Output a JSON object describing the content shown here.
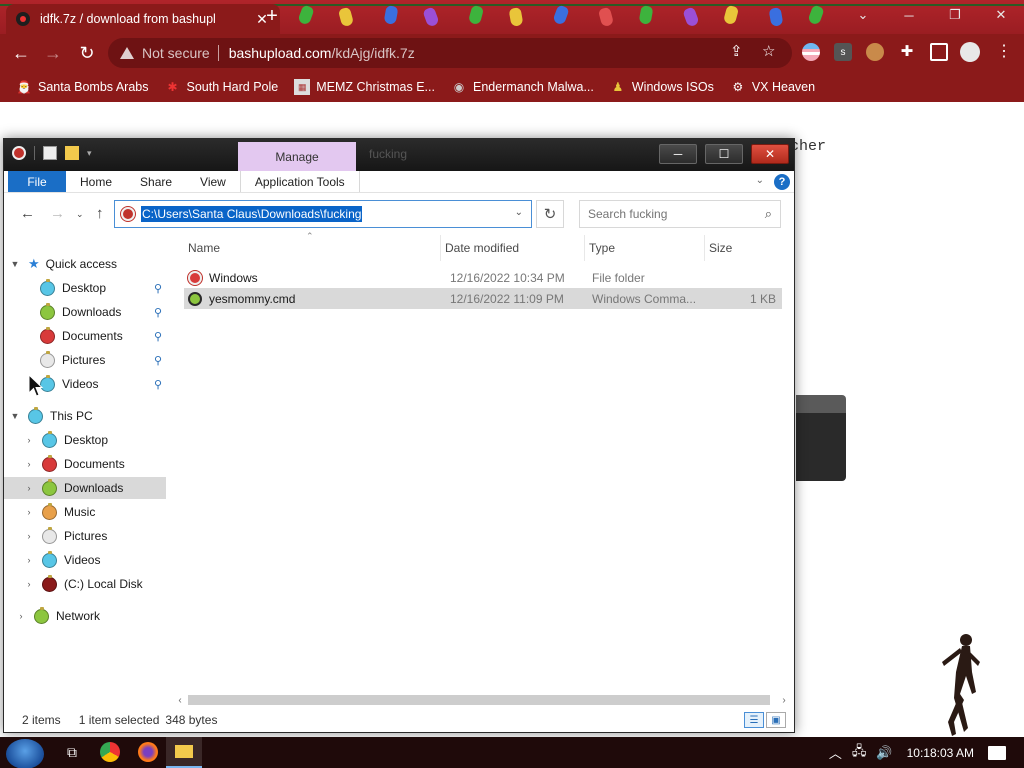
{
  "browser": {
    "tab_title": "idfk.7z / download from bashupl",
    "tab_close": "✕",
    "new_tab": "+",
    "not_secure": "Not secure",
    "url_host": "bashupload.com",
    "url_path": "/kdAjg/idfk.7z",
    "bookmarks": [
      {
        "label": "Santa Bombs Arabs",
        "icon": "santa-icon"
      },
      {
        "label": "South Hard Pole",
        "icon": "snowflake-icon"
      },
      {
        "label": "MEMZ Christmas E...",
        "icon": "memz-icon"
      },
      {
        "label": "Endermanch Malwa...",
        "icon": "raccoon-icon"
      },
      {
        "label": "Windows ISOs",
        "icon": "person-icon"
      },
      {
        "label": "VX Heaven",
        "icon": "vx-icon"
      }
    ]
  },
  "page_behind": {
    "text_fragment": "cher"
  },
  "explorer": {
    "window_title": "fucking",
    "manage_tab": "Manage",
    "ribbon": {
      "file": "File",
      "tabs": [
        "Home",
        "Share",
        "View",
        "Application Tools"
      ],
      "help": "?"
    },
    "address": "C:\\Users\\Santa Claus\\Downloads\\fucking",
    "search_placeholder": "Search fucking",
    "nav": {
      "quick_access": "Quick access",
      "quick_items": [
        "Desktop",
        "Downloads",
        "Documents",
        "Pictures",
        "Videos"
      ],
      "this_pc": "This PC",
      "pc_items": [
        "Desktop",
        "Documents",
        "Downloads",
        "Music",
        "Pictures",
        "Videos",
        "(C:) Local Disk"
      ],
      "network": "Network"
    },
    "columns": {
      "name": "Name",
      "date": "Date modified",
      "type": "Type",
      "size": "Size"
    },
    "files": [
      {
        "name": "Windows",
        "date": "12/16/2022 10:34 PM",
        "type": "File folder",
        "size": ""
      },
      {
        "name": "yesmommy.cmd",
        "date": "12/16/2022 11:09 PM",
        "type": "Windows Comma...",
        "size": "1 KB"
      }
    ],
    "status": {
      "items": "2 items",
      "selected": "1 item selected",
      "bytes": "348 bytes"
    }
  },
  "taskbar": {
    "clock": "10:18:03 AM"
  },
  "colors": {
    "chrome_red": "#8b1a1a",
    "selection_blue": "#0a64c8",
    "file_tab_blue": "#1a6ec6",
    "manage_purple": "#e3c8f0"
  }
}
